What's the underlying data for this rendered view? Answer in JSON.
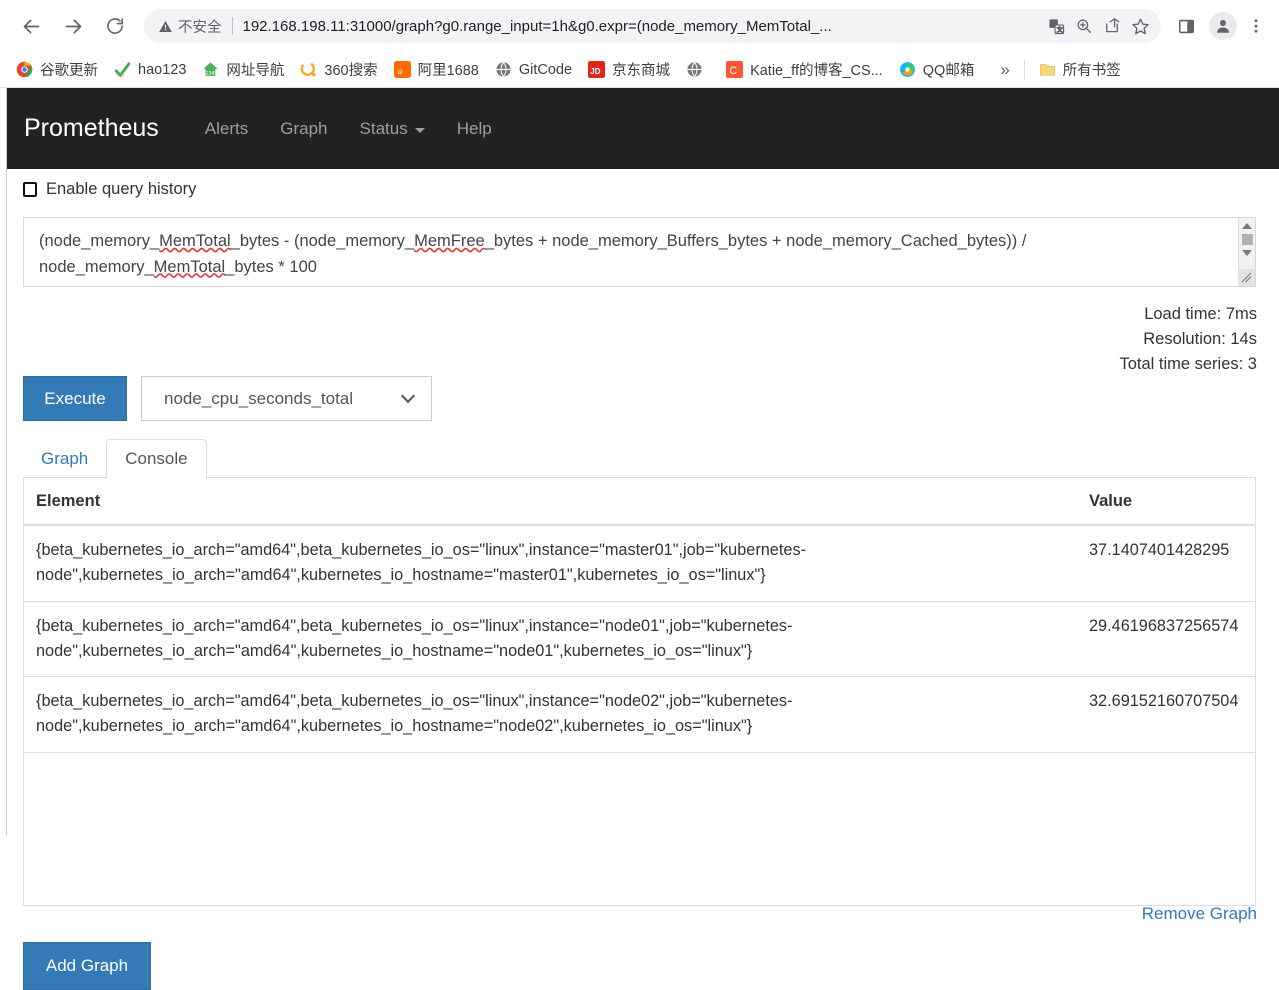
{
  "browser": {
    "security_label": "不安全",
    "url": "192.168.198.11:31000/graph?g0.range_input=1h&g0.expr=(node_memory_MemTotal_...",
    "nav": {
      "back": "back-arrow",
      "forward": "forward-arrow",
      "reload": "reload"
    },
    "omnibox_icons": [
      "translate-icon",
      "zoom-icon",
      "share-icon",
      "bookmark-star-icon"
    ],
    "chrome_icons": [
      "side-panel-icon",
      "profile-avatar",
      "three-dot-menu-icon"
    ],
    "bookmarks": [
      {
        "label": "谷歌更新",
        "icon": "chrome-icon",
        "color": "#4285f4"
      },
      {
        "label": "hao123",
        "icon": "hao123-icon",
        "color": "#35b558"
      },
      {
        "label": "网址导航",
        "icon": "2345-icon",
        "color": "#4caf50"
      },
      {
        "label": "360搜索",
        "icon": "360-icon",
        "color": "#f5a623"
      },
      {
        "label": "阿里1688",
        "icon": "alibaba-icon",
        "color": "#ff6a00"
      },
      {
        "label": "GitCode",
        "icon": "globe-icon",
        "color": "#8a8a8a"
      },
      {
        "label": "京东商城",
        "icon": "jd-icon",
        "color": "#e1251b"
      },
      {
        "label": "",
        "icon": "globe-icon",
        "color": "#8a8a8a"
      },
      {
        "label": "Katie_ff的博客_CS...",
        "icon": "csdn-icon",
        "color": "#fc5531"
      },
      {
        "label": "QQ邮箱",
        "icon": "qq-icon",
        "color": "#12b7f5"
      }
    ],
    "overflow_label": "»",
    "all_bookmarks_label": "所有书签"
  },
  "prometheus": {
    "brand": "Prometheus",
    "nav_items": [
      {
        "label": "Alerts",
        "has_caret": false
      },
      {
        "label": "Graph",
        "has_caret": false
      },
      {
        "label": "Status",
        "has_caret": true
      },
      {
        "label": "Help",
        "has_caret": false
      }
    ]
  },
  "query": {
    "history_label": "Enable query history",
    "history_checked": false,
    "expression_line1_a": "(node_memory_",
    "expression_sq1": "MemTotal",
    "expression_line1_b": "_bytes - (node_memory_",
    "expression_sq2": "MemFree",
    "expression_line1_c": "_bytes + node_memory_Buffers_bytes + node_memory_Cached_bytes)) /",
    "expression_line2_a": "node_memory_",
    "expression_sq3": "MemTotal",
    "expression_line2_b": "_bytes * 100",
    "expression_full": "(node_memory_MemTotal_bytes - (node_memory_MemFree_bytes + node_memory_Buffers_bytes + node_memory_Cached_bytes)) / node_memory_MemTotal_bytes * 100",
    "execute_label": "Execute",
    "metric_selected": "node_cpu_seconds_total"
  },
  "stats": {
    "load_time": "Load time: 7ms",
    "resolution": "Resolution: 14s",
    "total_series": "Total time series: 3"
  },
  "tabs": [
    {
      "label": "Graph",
      "active": false
    },
    {
      "label": "Console",
      "active": true
    }
  ],
  "results": {
    "columns": {
      "element": "Element",
      "value": "Value"
    },
    "rows": [
      {
        "element": "{beta_kubernetes_io_arch=\"amd64\",beta_kubernetes_io_os=\"linux\",instance=\"master01\",job=\"kubernetes-node\",kubernetes_io_arch=\"amd64\",kubernetes_io_hostname=\"master01\",kubernetes_io_os=\"linux\"}",
        "value": "37.1407401428295"
      },
      {
        "element": "{beta_kubernetes_io_arch=\"amd64\",beta_kubernetes_io_os=\"linux\",instance=\"node01\",job=\"kubernetes-node\",kubernetes_io_arch=\"amd64\",kubernetes_io_hostname=\"node01\",kubernetes_io_os=\"linux\"}",
        "value": "29.46196837256574"
      },
      {
        "element": "{beta_kubernetes_io_arch=\"amd64\",beta_kubernetes_io_os=\"linux\",instance=\"node02\",job=\"kubernetes-node\",kubernetes_io_arch=\"amd64\",kubernetes_io_hostname=\"node02\",kubernetes_io_os=\"linux\"}",
        "value": "32.69152160707504"
      }
    ]
  },
  "actions": {
    "remove_graph": "Remove Graph",
    "add_graph": "Add Graph"
  },
  "colors": {
    "primary_blue": "#337ab7",
    "navbar_dark": "#222222",
    "link_blue": "#337ab7"
  }
}
